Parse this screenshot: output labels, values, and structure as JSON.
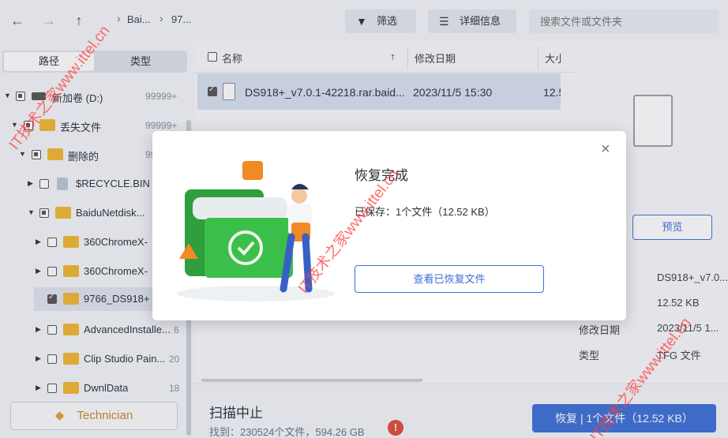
{
  "toolbar": {
    "back": "←",
    "forward": "→",
    "up": "↑",
    "crumb_1": "Bai...",
    "crumb_2": "97...",
    "filter_label": "筛选",
    "details_label": "详细信息",
    "search_placeholder": "搜索文件或文件夹"
  },
  "left": {
    "tab_path": "路径",
    "tab_type": "类型",
    "tree": [
      {
        "label": "新加卷 (D:)",
        "count": "99999+"
      },
      {
        "label": "丢失文件",
        "count": "99999+"
      },
      {
        "label": "删除的",
        "count": "99"
      },
      {
        "label": "$RECYCLE.BIN",
        "count": ""
      },
      {
        "label": "BaiduNetdisk...",
        "count": ""
      },
      {
        "label": "360ChromeX-",
        "count": ""
      },
      {
        "label": "360ChromeX-",
        "count": ""
      },
      {
        "label": "9766_DS918+",
        "count": ""
      },
      {
        "label": "AdvancedInstalle...",
        "count": "6"
      },
      {
        "label": "Clip Studio Pain...",
        "count": "20"
      },
      {
        "label": "DwnlData",
        "count": "18"
      }
    ],
    "technician_label": "Technician"
  },
  "files": {
    "col_name": "名称",
    "col_date": "修改日期",
    "col_size": "大小",
    "rows": [
      {
        "name": "DS918+_v7.0.1-42218.rar.baid...",
        "date": "2023/11/5 15:30",
        "size": "12.5"
      }
    ]
  },
  "details": {
    "preview_label": "预览",
    "props": [
      {
        "key": "",
        "value": "DS918+_v7.0..."
      },
      {
        "key": "",
        "value": "12.52 KB"
      },
      {
        "key": "修改日期",
        "value": "2023/11/5 1..."
      },
      {
        "key": "类型",
        "value": "TFG 文件"
      }
    ]
  },
  "bottom": {
    "scan_title": "扫描中止",
    "scan_info": "找到：230524个文件，594.26 GB",
    "warn": "!",
    "recover_label": "恢复 | 1个文件（12.52 KB）"
  },
  "modal": {
    "title": "恢复完成",
    "saved": "已保存：1个文件（12.52 KB）",
    "view_label": "查看已恢复文件",
    "close": "×"
  },
  "watermarks": [
    "IT技术之家www.ittel.cn",
    "IT技术之家www.ittel.cn",
    "IT技术之家www.ittel.cn"
  ],
  "colors": {
    "accent": "#3d6fd6",
    "folder": "#f2b731",
    "green": "#3cbf4a",
    "warn": "#e04a3a"
  }
}
